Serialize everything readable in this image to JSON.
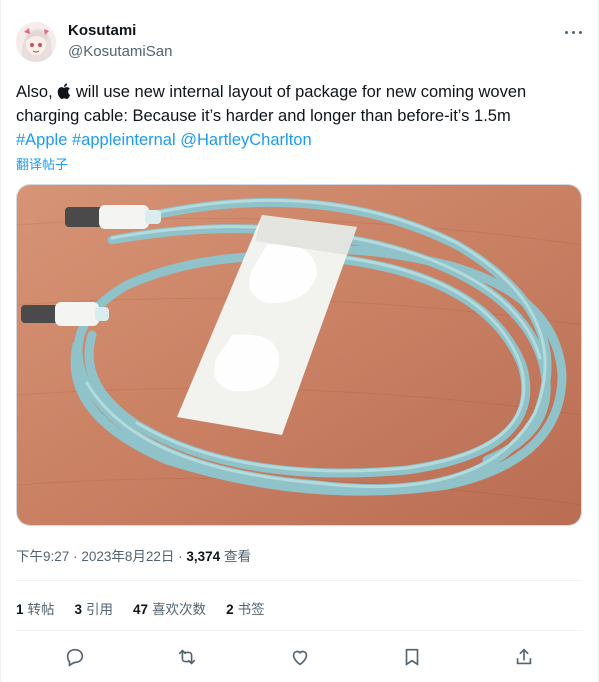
{
  "author": {
    "display_name": "Kosutami",
    "handle": "@KosutamiSan",
    "avatar_icon": "anime-avatar-icon"
  },
  "tweet": {
    "line1_prefix": "Also,",
    "line1_suffix": " will use new internal layout of package for new coming woven",
    "line2": "charging cable: Because it’s harder and longer than before-it’s 1.5m",
    "hashtags": [
      "#Apple",
      "#appleinternal",
      "@HartleyCharlton"
    ],
    "translate_label": "翻译帖子"
  },
  "meta": {
    "time": "下午9:27",
    "date": "2023年8月22日",
    "views_count": "3,374",
    "views_label": "查看"
  },
  "stats": [
    {
      "count": "1",
      "label": "转帖"
    },
    {
      "count": "3",
      "label": "引用"
    },
    {
      "count": "47",
      "label": "喜欢次数"
    },
    {
      "count": "2",
      "label": "书签"
    }
  ],
  "actions": [
    "reply-icon",
    "retweet-icon",
    "like-icon",
    "bookmark-icon",
    "share-icon"
  ],
  "colors": {
    "link": "#1d9bf0",
    "secondary_text": "#536471",
    "primary_text": "#0f1419",
    "divider": "#eff3f4"
  }
}
